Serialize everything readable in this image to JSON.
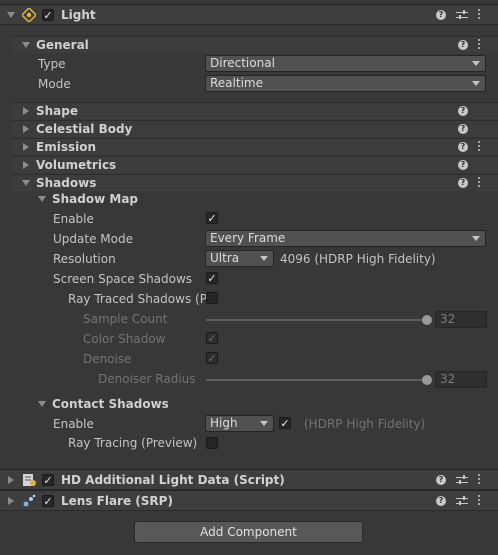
{
  "light_component": {
    "title": "Light",
    "enabled": true,
    "icon": "light-bulb-icon",
    "general": {
      "label": "General",
      "type_label": "Type",
      "type_value": "Directional",
      "mode_label": "Mode",
      "mode_value": "Realtime"
    },
    "collapsed_sections": [
      "Shape",
      "Celestial Body",
      "Emission",
      "Volumetrics"
    ],
    "shadows": {
      "label": "Shadows",
      "shadow_map": {
        "label": "Shadow Map",
        "enable_label": "Enable",
        "enable_checked": true,
        "update_mode_label": "Update Mode",
        "update_mode_value": "Every Frame",
        "resolution_label": "Resolution",
        "resolution_value": "Ultra",
        "resolution_info": "4096 (HDRP High Fidelity)",
        "screen_space_label": "Screen Space Shadows",
        "screen_space_checked": true,
        "ray_traced_label": "Ray Traced Shadows (P",
        "ray_traced_checked": false,
        "sample_count_label": "Sample Count",
        "sample_count_value": "32",
        "color_shadow_label": "Color Shadow",
        "color_shadow_checked": true,
        "denoise_label": "Denoise",
        "denoise_checked": true,
        "denoiser_radius_label": "Denoiser Radius",
        "denoiser_radius_value": "32"
      },
      "contact_shadows": {
        "label": "Contact Shadows",
        "enable_label": "Enable",
        "enable_value": "High",
        "enable_checked": true,
        "enable_info": "(HDRP High Fidelity)",
        "ray_tracing_label": "Ray Tracing (Preview)",
        "ray_tracing_checked": false
      }
    }
  },
  "hd_additional": {
    "title": "HD Additional Light Data (Script)",
    "enabled": true,
    "icon": "script-icon"
  },
  "lens_flare": {
    "title": "Lens Flare (SRP)",
    "enabled": true,
    "icon": "lens-flare-icon"
  },
  "add_component_label": "Add Component",
  "colors": {
    "background": "#383838",
    "header": "#3e3e3e",
    "field": "#515151"
  }
}
